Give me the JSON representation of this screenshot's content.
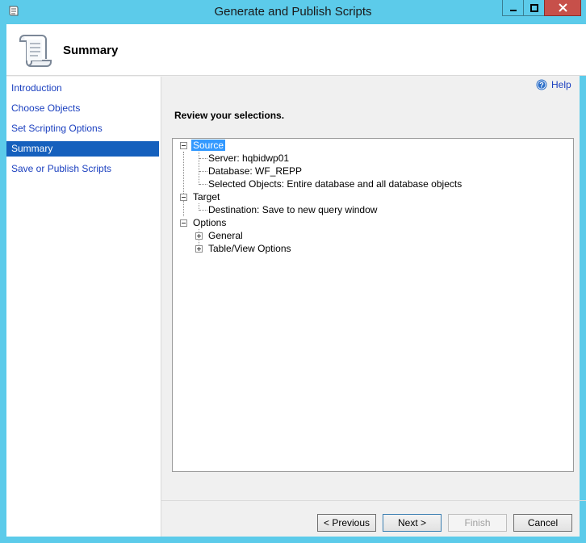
{
  "window": {
    "title": "Generate and Publish Scripts"
  },
  "header": {
    "title": "Summary"
  },
  "nav": {
    "items": [
      {
        "label": "Introduction"
      },
      {
        "label": "Choose Objects"
      },
      {
        "label": "Set Scripting Options"
      },
      {
        "label": "Summary",
        "selected": true
      },
      {
        "label": "Save or Publish Scripts"
      }
    ]
  },
  "help": {
    "label": "Help"
  },
  "main": {
    "heading": "Review your selections."
  },
  "tree": {
    "source": {
      "label": "Source",
      "children": [
        "Server: hqbidwp01",
        "Database: WF_REPP",
        "Selected Objects: Entire database and all database objects"
      ]
    },
    "target": {
      "label": "Target",
      "children": [
        "Destination: Save to new query window"
      ]
    },
    "options": {
      "label": "Options",
      "children": [
        "General",
        "Table/View Options"
      ]
    }
  },
  "buttons": {
    "previous": "< Previous",
    "next": "Next >",
    "finish": "Finish",
    "cancel": "Cancel"
  },
  "colors": {
    "titlebar": "#5ccbea",
    "selection": "#1560bd",
    "link": "#1a3fbf"
  }
}
